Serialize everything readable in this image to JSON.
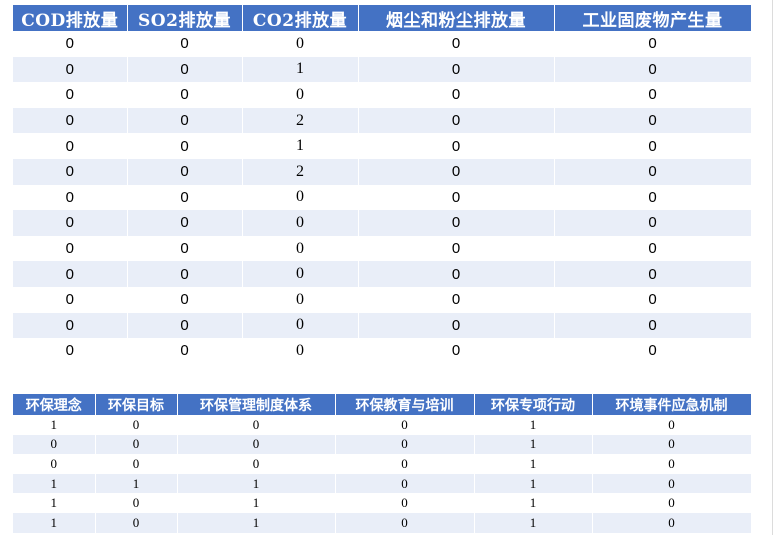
{
  "colors": {
    "header_bg": "#4472c4",
    "header_text": "#ffffff",
    "stripe": "#e9eef8"
  },
  "emissions_table": {
    "headers": [
      "COD排放量",
      "SO2排放量",
      "CO2排放量",
      "烟尘和粉尘排放量",
      "工业固废物产生量"
    ],
    "rows": [
      [
        "0",
        "0",
        "0",
        "0",
        "0"
      ],
      [
        "0",
        "0",
        "1",
        "0",
        "0"
      ],
      [
        "0",
        "0",
        "0",
        "0",
        "0"
      ],
      [
        "0",
        "0",
        "2",
        "0",
        "0"
      ],
      [
        "0",
        "0",
        "1",
        "0",
        "0"
      ],
      [
        "0",
        "0",
        "2",
        "0",
        "0"
      ],
      [
        "0",
        "0",
        "0",
        "0",
        "0"
      ],
      [
        "0",
        "0",
        "0",
        "0",
        "0"
      ],
      [
        "0",
        "0",
        "0",
        "0",
        "0"
      ],
      [
        "0",
        "0",
        "0",
        "0",
        "0"
      ],
      [
        "0",
        "0",
        "0",
        "0",
        "0"
      ],
      [
        "0",
        "0",
        "0",
        "0",
        "0"
      ],
      [
        "0",
        "0",
        "0",
        "0",
        "0"
      ]
    ]
  },
  "env_management_table": {
    "headers": [
      "环保理念",
      "环保目标",
      "环保管理制度体系",
      "环保教育与培训",
      "环保专项行动",
      "环境事件应急机制"
    ],
    "rows": [
      [
        "1",
        "0",
        "0",
        "0",
        "1",
        "0"
      ],
      [
        "0",
        "0",
        "0",
        "0",
        "1",
        "0"
      ],
      [
        "0",
        "0",
        "0",
        "0",
        "1",
        "0"
      ],
      [
        "1",
        "1",
        "1",
        "0",
        "1",
        "0"
      ],
      [
        "1",
        "0",
        "1",
        "0",
        "1",
        "0"
      ],
      [
        "1",
        "0",
        "1",
        "0",
        "1",
        "0"
      ]
    ]
  }
}
